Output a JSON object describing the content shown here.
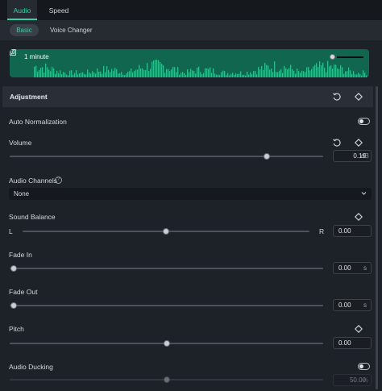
{
  "tabs": [
    {
      "label": "Audio",
      "active": true
    },
    {
      "label": "Speed",
      "active": false
    }
  ],
  "subtabs": [
    {
      "label": "Basic",
      "active": true
    },
    {
      "label": "Voice Changer",
      "active": false
    }
  ],
  "waveform": {
    "label": "1 minute",
    "color": "#11664f",
    "wave_color": "#2dbd8c",
    "volume": 0.0
  },
  "adjustment": {
    "title": "Adjustment",
    "auto_normalization": {
      "label": "Auto Normalization",
      "enabled": false
    },
    "volume": {
      "label": "Volume",
      "value": "0.19",
      "unit": "dB",
      "slider": 0.82
    },
    "audio_channels": {
      "label": "Audio Channels",
      "help": "?",
      "selected": "None"
    },
    "sound_balance": {
      "label": "Sound Balance",
      "left": "L",
      "right": "R",
      "value": "0.00",
      "slider": 0.5
    },
    "fade_in": {
      "label": "Fade In",
      "value": "0.00",
      "unit": "s",
      "slider": 0.0
    },
    "fade_out": {
      "label": "Fade Out",
      "value": "0.00",
      "unit": "s",
      "slider": 0.0
    },
    "pitch": {
      "label": "Pitch",
      "value": "0.00",
      "slider": 0.5
    },
    "audio_ducking": {
      "label": "Audio Ducking",
      "enabled": false,
      "value": "50.00",
      "unit": "%",
      "slider": 0.5
    }
  },
  "colors": {
    "accent": "#2fd3a6",
    "panel": "#1d2128",
    "header": "#2a2f37"
  }
}
